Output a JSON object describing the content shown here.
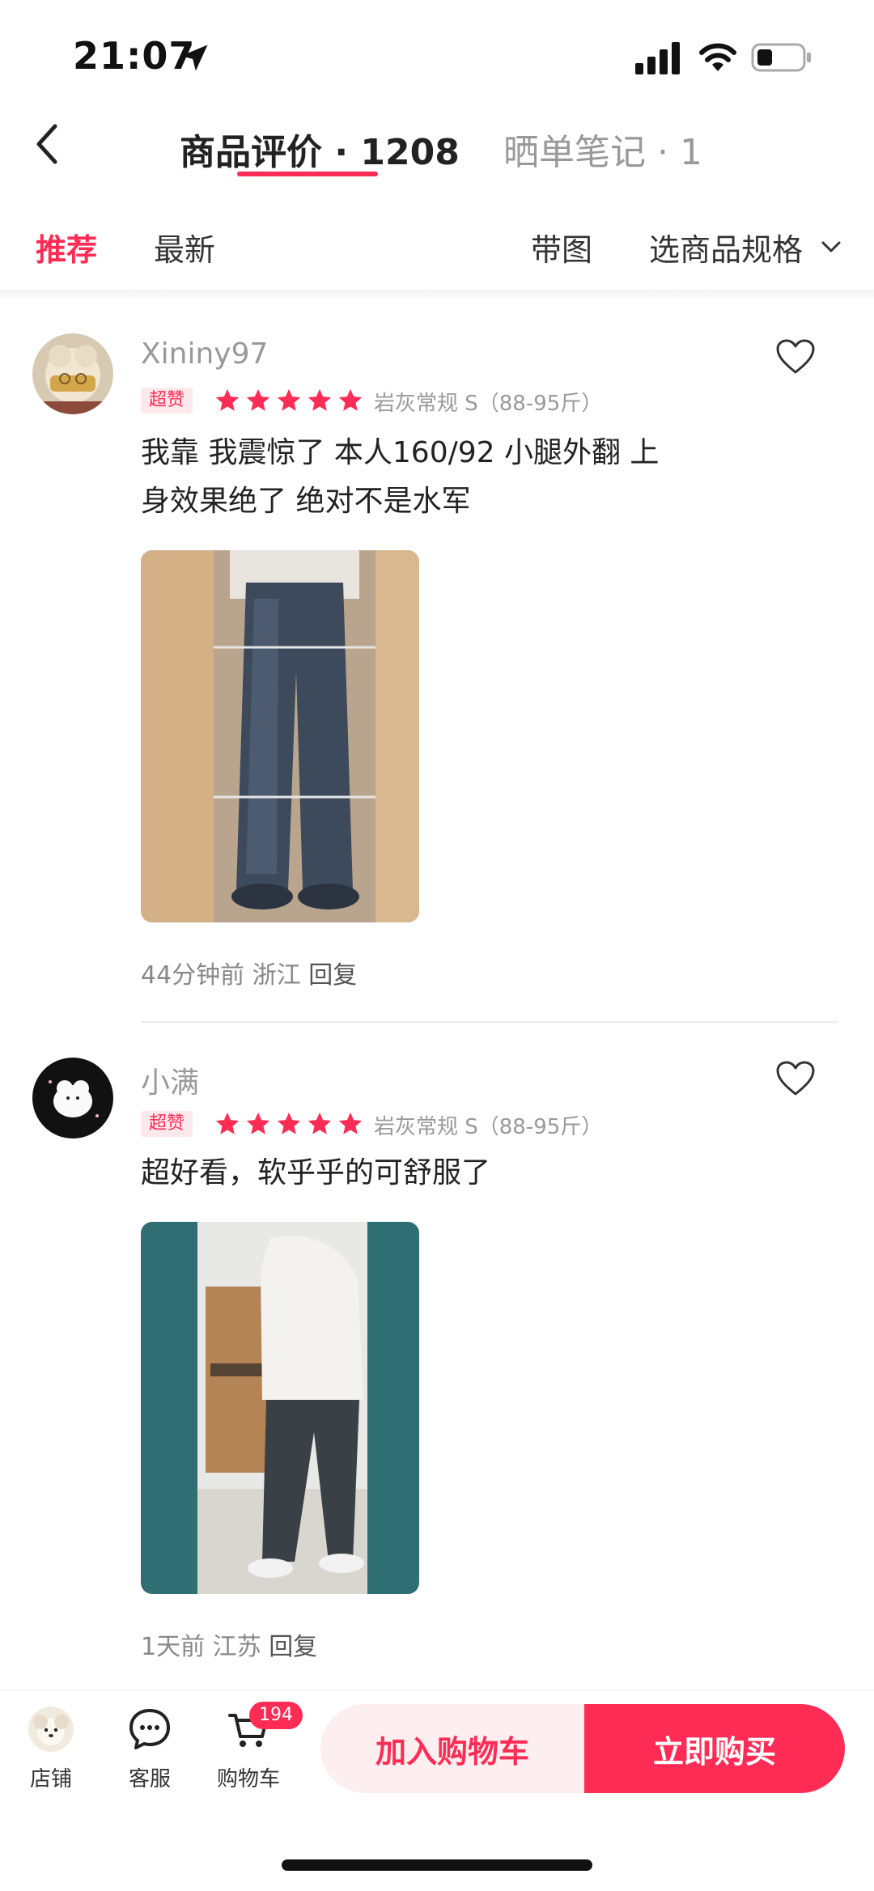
{
  "status_bar": {
    "time": "21:07"
  },
  "header": {
    "tabs": [
      {
        "label": "商品评价 · 1208",
        "active": true
      },
      {
        "label": "晒单笔记 · 1",
        "active": false
      }
    ]
  },
  "filters": {
    "recommend": "推荐",
    "latest": "最新",
    "with_pictures": "带图",
    "select_spec": "选商品规格"
  },
  "reviews": [
    {
      "username": "Xininy97",
      "badge": "超赞",
      "rating": 5,
      "spec": "岩灰常规  S（88-95斤）",
      "content_line1": "我靠 我震惊了 本人160/92 小腿外翻 上",
      "content_line2": "身效果绝了 绝对不是水军",
      "time": "44分钟前",
      "location": "浙江",
      "reply": "回复"
    },
    {
      "username": "小满",
      "badge": "超赞",
      "rating": 5,
      "spec": "岩灰常规  S（88-95斤）",
      "content_line1": "超好看，软乎乎的可舒服了",
      "time": "1天前",
      "location": "江苏",
      "reply": "回复"
    }
  ],
  "bottom_bar": {
    "store": "店铺",
    "service": "客服",
    "cart": "购物车",
    "cart_count": "194",
    "add_to_cart": "加入购物车",
    "buy_now": "立即购买"
  },
  "colors": {
    "accent": "#ff2c55",
    "muted_text": "#999999"
  }
}
